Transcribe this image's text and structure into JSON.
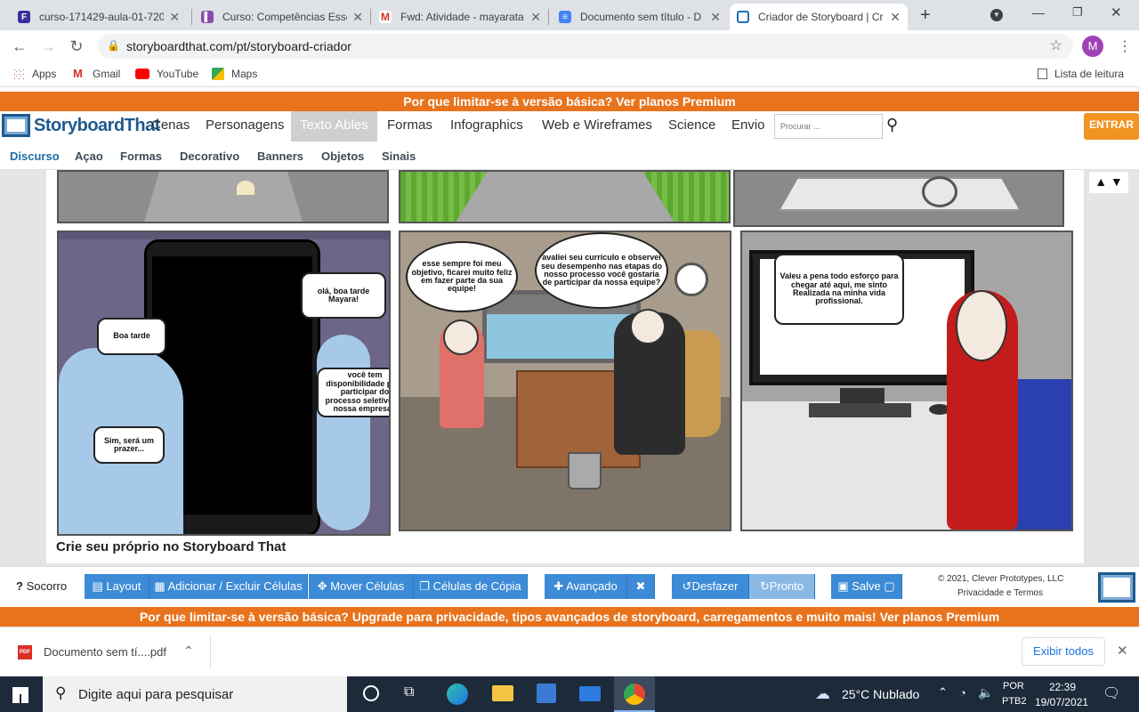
{
  "browser": {
    "tabs": [
      {
        "title": "curso-171429-aula-01-720"
      },
      {
        "title": "Curso: Competências Esse"
      },
      {
        "title": "Fwd: Atividade - mayarata"
      },
      {
        "title": "Documento sem título - D"
      },
      {
        "title": "Criador de Storyboard | Cr"
      }
    ],
    "url": "storyboardthat.com/pt/storyboard-criador",
    "profile_initial": "M",
    "bookmarks": [
      "Apps",
      "Gmail",
      "YouTube",
      "Maps"
    ],
    "reading_list": "Lista de leitura"
  },
  "site": {
    "promo_top": "Por que limitar-se à versão básica? Ver planos Premium",
    "logo": "StoryboardThat",
    "nav": [
      "Cenas",
      "Personagens",
      "Texto Ables",
      "Formas",
      "Infographics",
      "Web e Wireframes",
      "Science",
      "Envio"
    ],
    "search_placeholder": "Procurar ...",
    "login_label": "ENTRAR",
    "subnav": [
      "Discurso",
      "Açao",
      "Formas",
      "Decorativo",
      "Banners",
      "Objetos",
      "Sinais"
    ]
  },
  "storyboard": {
    "panel4": {
      "bubbles": [
        "olá, boa tarde Mayara!",
        "Boa tarde",
        "você tem disponibilidade para participar do processo seletivo da nossa empresa?",
        "Sim, será um prazer..."
      ]
    },
    "panel5": {
      "bubbles": [
        "esse sempre foi meu objetivo, ficarei muito feliz em fazer parte da sua equipe!",
        "avaliei seu currículo e observei seu desempenho nas etapas do nosso processo você gostaria de participar da nossa equipe?"
      ]
    },
    "panel6": {
      "bubbles": [
        "Valeu a pena todo esforço para chegar até aqui, me sinto Realizada na minha vida profissional."
      ]
    },
    "cta": "Crie seu próprio no Storyboard That"
  },
  "toolbar": {
    "help": "Socorro",
    "layout": "Layout",
    "add_remove": "Adicionar / Excluir Células",
    "move": "Mover Células",
    "copy": "Células de Cópia",
    "advanced": "Avançado",
    "undo": "Desfazer",
    "redo": "Pronto",
    "save": "Salve",
    "copyright": "© 2021, Clever Prototypes, LLC",
    "privacy": "Privacidade e Termos"
  },
  "promo_bottom": "Por que limitar-se à versão básica? Upgrade para privacidade, tipos avançados de storyboard, carregamentos e muito mais! Ver planos Premium",
  "downloads": {
    "file": "Documento sem tí....pdf",
    "show_all": "Exibir todos"
  },
  "taskbar": {
    "search": "Digite aqui para pesquisar",
    "weather": "25°C  Nublado",
    "lang": "POR",
    "lang2": "PTB2",
    "time": "22:39",
    "date": "19/07/2021"
  },
  "colors": {
    "orange": "#e8731c",
    "blue": "#3d8bd6",
    "nav_selected": "#cfcfcf"
  }
}
